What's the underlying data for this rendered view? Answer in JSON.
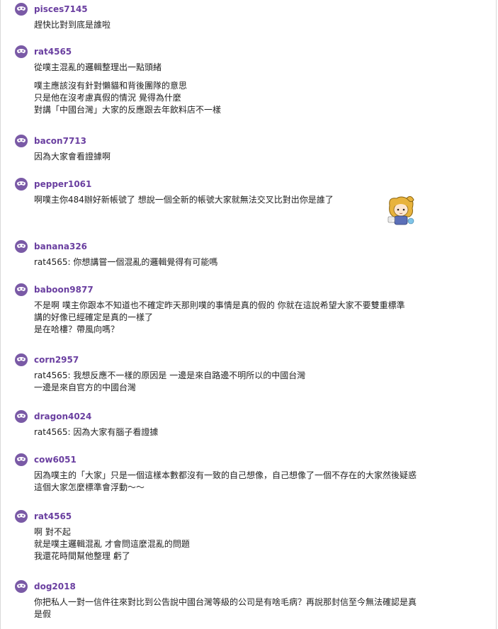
{
  "comments": [
    {
      "user": "pisces7145",
      "lines": [
        "趕快比對到底是誰啦"
      ]
    },
    {
      "user": "rat4565",
      "lines": [
        "從噗主混亂的邏輯整理出一點頭緒"
      ],
      "extra": [
        "噗主應該沒有針對懶貓和背後團隊的意思",
        "只是他在沒考慮真假的情況 覺得為什麼",
        "對講「中國台灣」大家的反應跟去年飲料店不一樣"
      ]
    },
    {
      "user": "bacon7713",
      "lines": [
        "因為大家會看證據啊"
      ]
    },
    {
      "user": "pepper1061",
      "lines": [
        "啊噗主你484辦好新帳號了 想說一個全新的帳號大家就無法交叉比對出你是誰了"
      ]
    },
    {
      "user": "banana326",
      "lines": [
        "rat4565: 你想講嘗一個混亂的邏輯覺得有可能嗎"
      ]
    },
    {
      "user": "baboon9877",
      "lines": [
        "不是啊 噗主你跟本不知道也不確定昨天那則噗的事情是真的假的 你就在這說希望大家不要雙重標準",
        "講的好像已經確定是真的一樣了",
        "是在哈樓？帶風向嗎？"
      ]
    },
    {
      "user": "corn2957",
      "lines": [
        "rat4565: 我想反應不一樣的原因是 一邊是來自路邊不明所以的中國台灣",
        "一邊是來自官方的中國台灣"
      ]
    },
    {
      "user": "dragon4024",
      "lines": [
        "rat4565: 因為大家有腦子看證據"
      ]
    },
    {
      "user": "cow6051",
      "lines": [
        "因為噗主的「大家」只是一個這樣本數都沒有一致的自己想像，自己想像了一個不存在的大家然後疑惑",
        "這個大家怎麼標準會浮動～～"
      ]
    },
    {
      "user": "rat4565",
      "lines": [
        "啊 對不起",
        "就是噗主邏輯混亂 才會問這麼混亂的問題",
        "我還花時間幫他整理 虧了"
      ]
    },
    {
      "user": "dog2018",
      "lines": [
        "你把私人一對一信件往來對比到公告說中國台灣等級的公司是有啥毛病？再說那封信至今無法確認是真",
        "是假"
      ]
    }
  ],
  "colors": {
    "username": "#6a3fa0",
    "avatar": "#7a5aa6"
  },
  "icons": {
    "avatar": "mask-icon",
    "sticker": "girl-sticker-icon"
  }
}
